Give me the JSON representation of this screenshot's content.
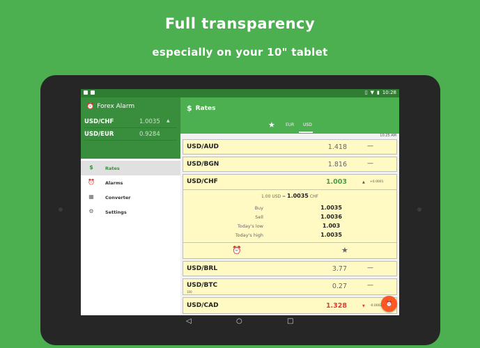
{
  "headline": "Full transparency",
  "subheadline": "especially on your 10\" tablet",
  "status_bar": {
    "time": "10:28"
  },
  "drawer": {
    "app_title": "Forex Alarm",
    "pairs": [
      {
        "pair": "USD/CHF",
        "value": "1.0035",
        "arrow": "▲"
      },
      {
        "pair": "USD/EUR",
        "value": "0.9284",
        "arrow": ""
      }
    ],
    "menu": [
      {
        "icon": "dollar-icon",
        "glyph": "$",
        "label": "Rates",
        "active": true
      },
      {
        "icon": "alarm-clock-icon",
        "glyph": "⏰",
        "label": "Alarms",
        "active": false
      },
      {
        "icon": "calculator-icon",
        "glyph": "▦",
        "label": "Converter",
        "active": false
      },
      {
        "icon": "gear-icon",
        "glyph": "⚙",
        "label": "Settings",
        "active": false
      }
    ]
  },
  "rates_panel": {
    "title": "Rates",
    "tabs": [
      "EUR",
      "USD"
    ],
    "active_tab": "USD",
    "timestamp": "10:25 AM",
    "rows": [
      {
        "pair": "USD/AUD",
        "rate": "1.418",
        "trend": "flat",
        "change": ""
      },
      {
        "pair": "USD/BGN",
        "rate": "1.816",
        "trend": "flat",
        "change": ""
      },
      {
        "pair": "USD/CHF",
        "rate": "1.003",
        "trend": "up",
        "change": "+0.0001"
      },
      {
        "pair": "USD/BRL",
        "rate": "3.77",
        "trend": "flat",
        "change": ""
      },
      {
        "pair": "USD/BTC",
        "rate": "0.27",
        "trend": "flat",
        "change": "",
        "note": "100"
      },
      {
        "pair": "USD/CAD",
        "rate": "1.328",
        "trend": "down",
        "change": "-0.0002"
      }
    ],
    "expanded": {
      "conversion_prefix": "1.00 USD =",
      "conversion_value": "1.0035",
      "conversion_unit": "CHF",
      "details": [
        {
          "label": "Buy",
          "value": "1.0035"
        },
        {
          "label": "Sell",
          "value": "1.0036"
        },
        {
          "label": "Today's low",
          "value": "1.003"
        },
        {
          "label": "Today's high",
          "value": "1.0035"
        }
      ]
    }
  },
  "colors": {
    "background": "#4caf50",
    "toolbar": "#4caf50",
    "drawer_header": "#388e3c",
    "card": "#fff9c4",
    "up": "#43a047",
    "down": "#e53935",
    "fab": "#ff5722"
  }
}
